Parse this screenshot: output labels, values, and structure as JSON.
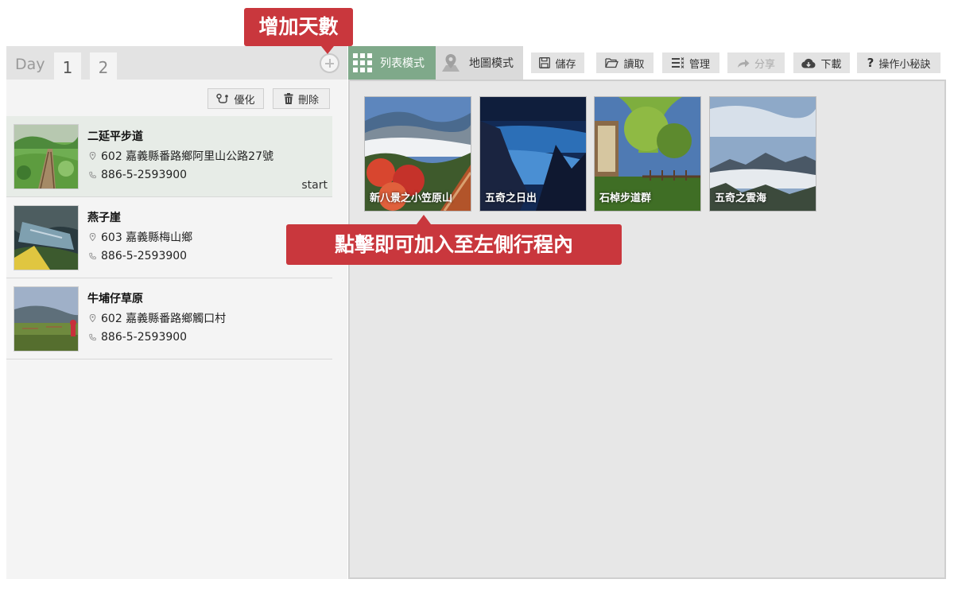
{
  "colors": {
    "accent_green": "#7fa98a",
    "callout_red": "#c9373d",
    "toolbar_button_bg": "#e3e3e3"
  },
  "callouts": {
    "add_days": "增加天數",
    "click_to_add": "點擊即可加入至左側行程內"
  },
  "day_bar": {
    "label": "Day",
    "tabs": [
      "1",
      "2"
    ],
    "active_tab": "1",
    "add_icon": "plus-circle-icon"
  },
  "list_actions": {
    "optimize_label": "優化",
    "optimize_icon": "route-icon",
    "delete_label": "刪除",
    "delete_icon": "trash-icon"
  },
  "itinerary": [
    {
      "name": "二延平步道",
      "address": "602 嘉義縣番路鄉阿里山公路27號",
      "phone": "886-5-2593900",
      "start_label": "start"
    },
    {
      "name": "燕子崖",
      "address": "603 嘉義縣梅山鄉",
      "phone": "886-5-2593900"
    },
    {
      "name": "牛埔仔草原",
      "address": "602 嘉義縣番路鄉觸口村",
      "phone": "886-5-2593900"
    }
  ],
  "view_modes": {
    "list_label": "列表模式",
    "list_icon": "grid-icon",
    "map_label": "地圖模式",
    "map_icon": "map-pin-icon"
  },
  "toolbar": {
    "save": {
      "label": "儲存",
      "icon": "floppy-icon"
    },
    "load": {
      "label": "讀取",
      "icon": "folder-icon"
    },
    "manage": {
      "label": "管理",
      "icon": "manage-list-icon"
    },
    "share": {
      "label": "分享",
      "icon": "share-arrow-icon"
    },
    "download": {
      "label": "下載",
      "icon": "cloud-download-icon"
    },
    "tips": {
      "label": "操作小秘訣",
      "icon": "question-icon"
    }
  },
  "attractions": [
    "新八景之小笠原山",
    "五奇之日出",
    "石棹步道群",
    "五奇之雲海"
  ]
}
